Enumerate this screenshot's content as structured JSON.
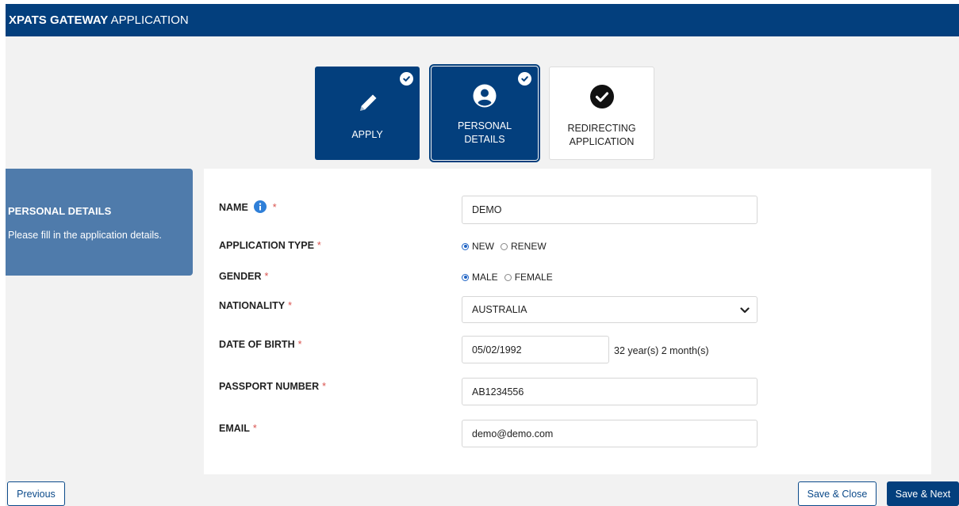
{
  "header": {
    "brand_bold": "XPATS GATEWAY",
    "brand_rest": " APPLICATION"
  },
  "steps": [
    {
      "label_lines": [
        "APPLY"
      ],
      "icon": "pencil-icon",
      "completed": true
    },
    {
      "label_lines": [
        "PERSONAL",
        "DETAILS"
      ],
      "icon": "user-circle-icon",
      "completed": true,
      "active": true
    },
    {
      "label_lines": [
        "REDIRECTING",
        "APPLICATION"
      ],
      "icon": "check-circle-icon",
      "completed": false
    }
  ],
  "side": {
    "title": "PERSONAL DETAILS",
    "description": "Please fill in the application details."
  },
  "form": {
    "required_mark": "*",
    "name": {
      "label": "NAME",
      "value": "DEMO"
    },
    "application_type": {
      "label": "APPLICATION TYPE",
      "options": [
        "NEW",
        "RENEW"
      ],
      "selected": "NEW"
    },
    "gender": {
      "label": "GENDER",
      "options": [
        "MALE",
        "FEMALE"
      ],
      "selected": "MALE"
    },
    "nationality": {
      "label": "NATIONALITY",
      "value": "AUSTRALIA"
    },
    "dob": {
      "label": "DATE OF BIRTH",
      "value": "05/02/1992",
      "age": "32 year(s) 2 month(s)"
    },
    "passport": {
      "label": "PASSPORT NUMBER",
      "value": "AB1234556"
    },
    "email": {
      "label": "EMAIL",
      "value": "demo@demo.com"
    }
  },
  "buttons": {
    "previous": "Previous",
    "save_close": "Save & Close",
    "save_next": "Save & Next"
  },
  "colors": {
    "primary": "#033f7d",
    "side_panel": "#4f7bab",
    "required": "#d9534f",
    "page_bg": "#f2f2f2"
  }
}
